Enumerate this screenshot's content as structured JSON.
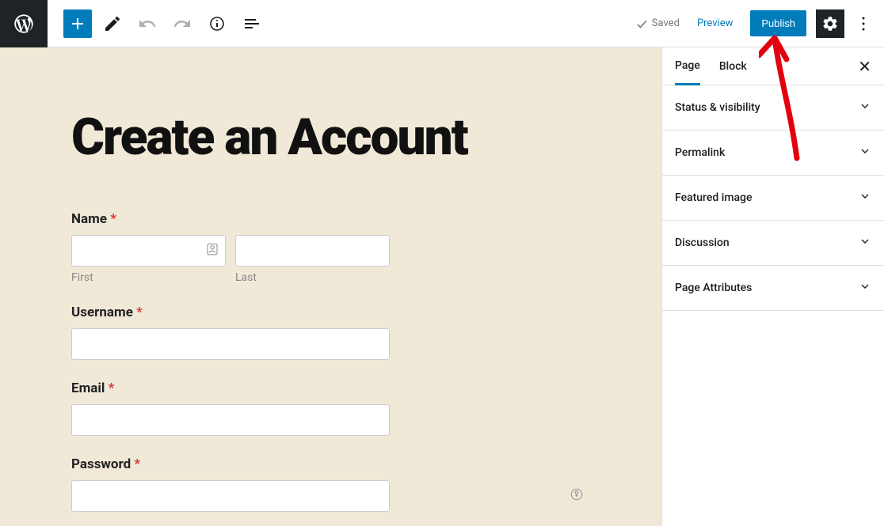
{
  "topbar": {
    "saved_label": "Saved",
    "preview_label": "Preview",
    "publish_label": "Publish"
  },
  "sidebar": {
    "tabs": [
      {
        "label": "Page",
        "active": true
      },
      {
        "label": "Block",
        "active": false
      }
    ],
    "panels": [
      {
        "label": "Status & visibility"
      },
      {
        "label": "Permalink"
      },
      {
        "label": "Featured image"
      },
      {
        "label": "Discussion"
      },
      {
        "label": "Page Attributes"
      }
    ]
  },
  "canvas": {
    "title": "Create an Account",
    "form": {
      "name": {
        "label": "Name",
        "first_sub": "First",
        "last_sub": "Last"
      },
      "username": {
        "label": "Username"
      },
      "email": {
        "label": "Email"
      },
      "password": {
        "label": "Password"
      }
    },
    "required_marker": "*"
  }
}
